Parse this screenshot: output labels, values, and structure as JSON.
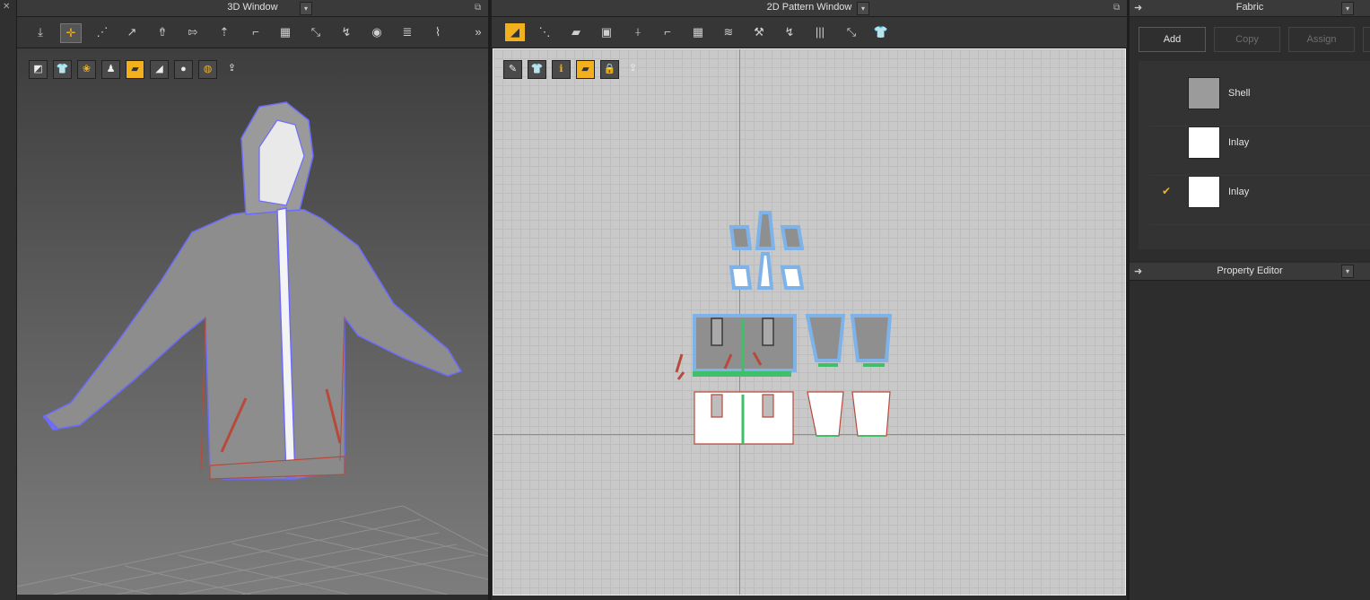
{
  "window3d": {
    "title": "3D Window",
    "toolbar_icons": [
      "simulation-icon",
      "select-move-icon",
      "edit-pattern-icon",
      "edit-point-icon",
      "fold-arrangement-icon",
      "move-icon",
      "arrangement-icon",
      "pin-icon",
      "tack-icon",
      "fold-icon",
      "edit-curve-icon",
      "strengthen-icon",
      "measure-icon",
      "zipper-icon",
      "expand-icon"
    ],
    "sub_icons": [
      "avatar-view-icon",
      "garment-view-icon",
      "textures-icon",
      "avatar-icon",
      "fabric-view-icon",
      "lighting-icon",
      "hide-avatar-icon",
      "gizmo-icon",
      "export-icon"
    ]
  },
  "window2d": {
    "title": "2D Pattern Window",
    "toolbar_icons": [
      "transform-pattern-icon",
      "edit-point-icon",
      "polygon-icon",
      "rectangle-icon",
      "internal-line-icon",
      "seam-icon",
      "grid-icon",
      "fold-icon",
      "sewing-icon",
      "tack-icon",
      "pleats-icon",
      "measure-icon",
      "garment-icon"
    ],
    "sub_icons": [
      "pencil-icon",
      "garment-view-icon",
      "info-icon",
      "fabric-view-icon",
      "lock-icon",
      "export-icon"
    ]
  },
  "fabric": {
    "title": "Fabric",
    "buttons": {
      "add": "Add",
      "copy": "Copy",
      "assign": "Assign"
    },
    "items": [
      {
        "name": "Shell",
        "color": "#9b9b9b",
        "checked": false
      },
      {
        "name": "Inlay",
        "color": "#ffffff",
        "checked": false
      },
      {
        "name": "Inlay",
        "color": "#ffffff",
        "checked": true
      }
    ],
    "check_mark": "✔"
  },
  "property_editor": {
    "title": "Property Editor"
  },
  "colors": {
    "accent": "#f2b01e",
    "seam_blue": "#6d6bff",
    "seam_red": "#b84a3b",
    "pattern_green": "#3fbf6a"
  }
}
